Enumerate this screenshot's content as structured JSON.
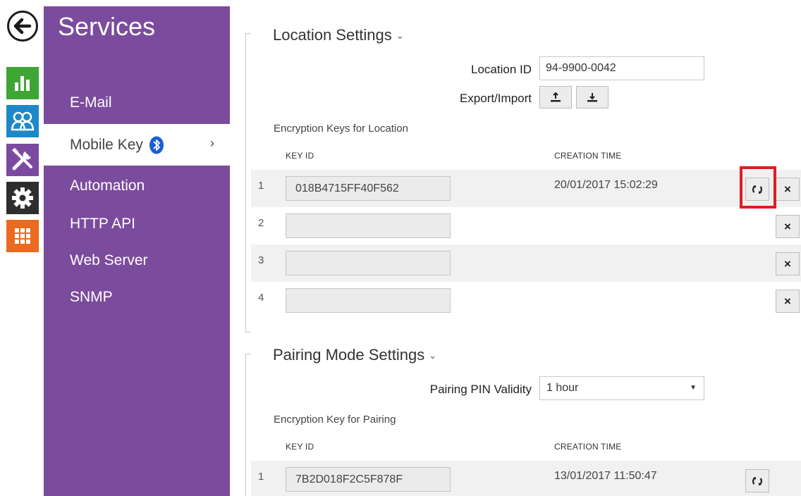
{
  "sidebar": {
    "title": "Services",
    "items": [
      {
        "label": "E-Mail"
      },
      {
        "label": "Mobile Key"
      },
      {
        "label": "Automation"
      },
      {
        "label": "HTTP API"
      },
      {
        "label": "Web Server"
      },
      {
        "label": "SNMP"
      }
    ],
    "active_chevron": "›"
  },
  "rail": {
    "icons": [
      "back-arrow-icon",
      "status-chart-icon",
      "users-icon",
      "tools-icon",
      "gear-icon",
      "apps-grid-icon"
    ],
    "colors": {
      "status": "#3fa535",
      "users": "#1e88c7",
      "services": "#7b4aa0",
      "settings": "#2e2e2e",
      "apps": "#ea6a1f"
    }
  },
  "location": {
    "title": "Location Settings",
    "chevron": "⌄",
    "location_id_label": "Location ID",
    "location_id_value": "94-9900-0042",
    "export_import_label": "Export/Import",
    "keys_title": "Encryption Keys for Location",
    "col_key_id": "KEY ID",
    "col_creation_time": "CREATION TIME",
    "rows": [
      {
        "num": "1",
        "key": "018B4715FF40F562",
        "time": "20/01/2017 15:02:29"
      },
      {
        "num": "2",
        "key": "",
        "time": ""
      },
      {
        "num": "3",
        "key": "",
        "time": ""
      },
      {
        "num": "4",
        "key": "",
        "time": ""
      }
    ]
  },
  "pairing": {
    "title": "Pairing Mode Settings",
    "chevron": "⌄",
    "pin_validity_label": "Pairing PIN Validity",
    "pin_validity_value": "1 hour",
    "select_caret": "▼",
    "key_title": "Encryption Key for Pairing",
    "col_key_id": "KEY ID",
    "col_creation_time": "CREATION TIME",
    "rows": [
      {
        "num": "1",
        "key": "7B2D018F2C5F878F",
        "time": "13/01/2017 11:50:47"
      }
    ]
  },
  "buttons": {
    "delete_glyph": "×"
  },
  "colors": {
    "panel": "#7b4b9d",
    "highlight": "#e31b23",
    "row_alt": "#f1f1f1"
  }
}
